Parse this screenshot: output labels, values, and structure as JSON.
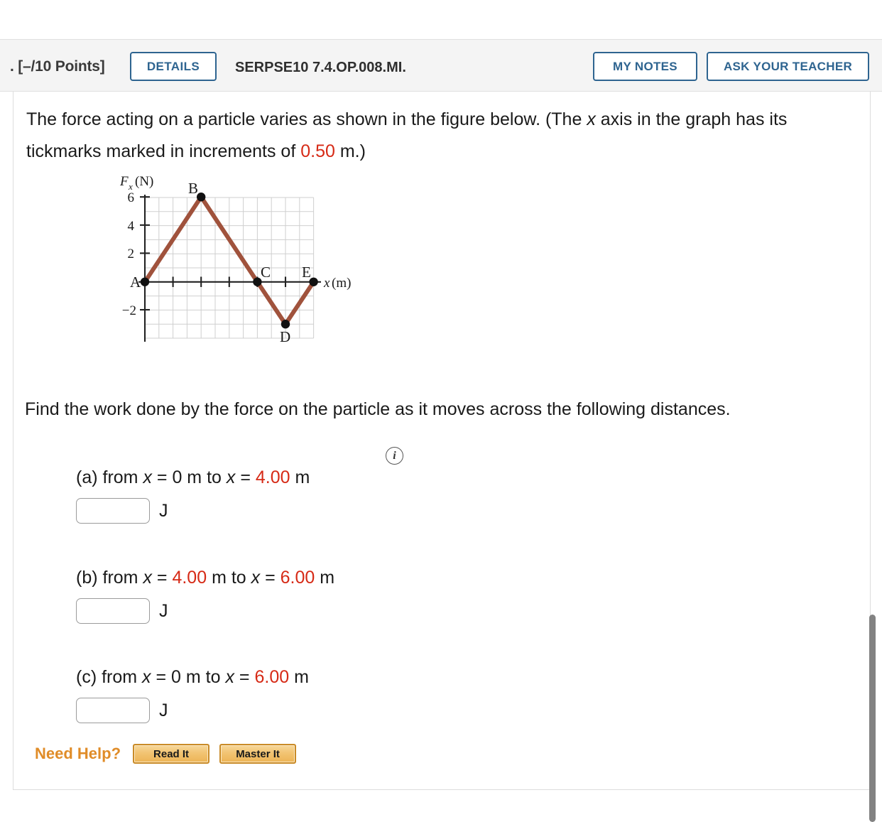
{
  "header": {
    "points_label": ". [–/10 Points]",
    "details_label": "DETAILS",
    "question_code": "SERPSE10 7.4.OP.008.MI.",
    "my_notes_label": "MY NOTES",
    "ask_teacher_label": "ASK YOUR TEACHER",
    "accent_color": "#2e6490"
  },
  "question": {
    "intro_part1": "The force acting on a particle varies as shown in the figure below. (The ",
    "intro_italic_x": "x",
    "intro_part2": " axis in the graph has its tickmarks marked in increments of ",
    "intro_value": "0.50",
    "intro_part3": " m.)",
    "find_text": "Find the work done by the force on the particle as it moves across the following distances.",
    "info_icon_glyph": "i",
    "highlight_color": "#d62a16"
  },
  "parts": [
    {
      "id": "a",
      "prefix": "(a) from ",
      "var1": "x",
      "eq1": " = ",
      "from_value": "0",
      "from_unit": " m to ",
      "var2": "x",
      "eq2": " = ",
      "to_value": "4.00",
      "to_unit": " m",
      "to_value_highlighted": true,
      "from_value_highlighted": false,
      "input_value": "",
      "unit": "J"
    },
    {
      "id": "b",
      "prefix": "(b) from ",
      "var1": "x",
      "eq1": " = ",
      "from_value": "4.00",
      "from_unit": " m to ",
      "var2": "x",
      "eq2": " = ",
      "to_value": "6.00",
      "to_unit": " m",
      "to_value_highlighted": true,
      "from_value_highlighted": true,
      "input_value": "",
      "unit": "J"
    },
    {
      "id": "c",
      "prefix": "(c) from ",
      "var1": "x",
      "eq1": " = ",
      "from_value": "0",
      "from_unit": " m to ",
      "var2": "x",
      "eq2": " = ",
      "to_value": "6.00",
      "to_unit": " m",
      "to_value_highlighted": true,
      "from_value_highlighted": false,
      "input_value": "",
      "unit": "J"
    }
  ],
  "need_help": {
    "label": "Need Help?",
    "read_it_label": "Read It",
    "master_it_label": "Master It",
    "label_color": "#e08c28"
  },
  "chart_data": {
    "type": "line",
    "title": "",
    "ylabel": "F_x (N)",
    "xlabel": "x (m)",
    "xlim": [
      0,
      6
    ],
    "ylim": [
      -4,
      7
    ],
    "grid": true,
    "grid_step_x": 0.5,
    "grid_step_y": 1,
    "y_ticks": [
      6,
      4,
      2,
      -2
    ],
    "y_tick_labels": [
      "6",
      "4",
      "2",
      "−2"
    ],
    "x_ticks": [
      1,
      2,
      3,
      4,
      5
    ],
    "x_tick_labels": [
      "",
      "",
      "",
      "",
      ""
    ],
    "line_color": "#a0523c",
    "point_color": "#111111",
    "points": [
      {
        "label": "A",
        "x": 0,
        "y": 0
      },
      {
        "label": "B",
        "x": 2,
        "y": 6
      },
      {
        "label": "C",
        "x": 4,
        "y": 0
      },
      {
        "label": "D",
        "x": 5,
        "y": -3
      },
      {
        "label": "E",
        "x": 6,
        "y": 0
      }
    ],
    "x": [
      0,
      2,
      4,
      5,
      6
    ],
    "values": [
      0,
      6,
      0,
      -3,
      0
    ]
  }
}
